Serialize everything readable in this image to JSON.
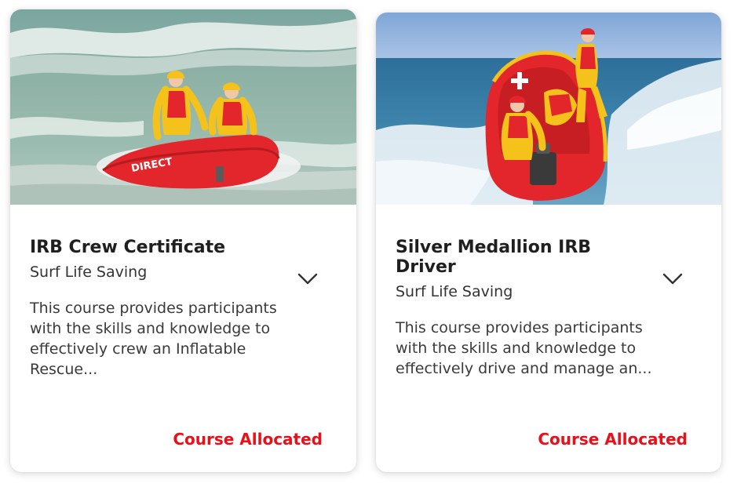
{
  "courses": [
    {
      "title": "IRB Crew Certificate",
      "provider": "Surf Life Saving",
      "description": "This course provides participants with the skills and knowledge to effectively crew an Inflatable Rescue...",
      "status": "Course Allocated",
      "boat_text": "DIRECT"
    },
    {
      "title": "Silver Medallion IRB Driver",
      "provider": "Surf Life Saving",
      "description": "This course provides participants with the skills and knowledge to effectively drive and manage an...",
      "status": "Course Allocated"
    }
  ],
  "colors": {
    "status": "#e8101a",
    "title": "#1f1f1f",
    "boat_red": "#e3262b",
    "vest_yellow": "#f4c21a"
  },
  "icons": {
    "expand": "chevron-down-icon"
  }
}
